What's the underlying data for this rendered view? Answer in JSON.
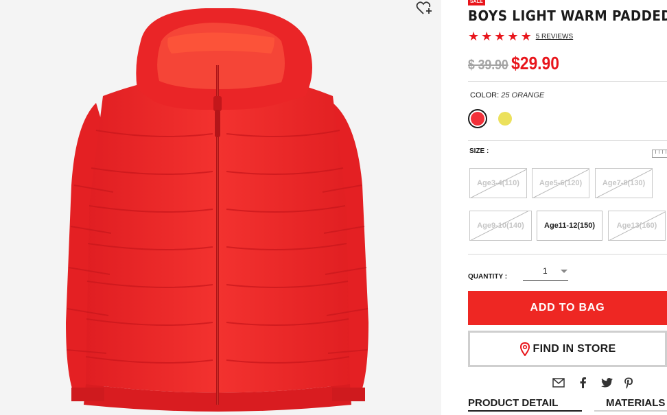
{
  "product": {
    "sale_badge": "SALE",
    "title": "BOYS LIGHT WARM PADDED P",
    "rating_stars": 5,
    "reviews_link": "5 REVIEWS",
    "old_price": "$ 39.90",
    "new_price": "$29.90"
  },
  "color": {
    "label": "COLOR:",
    "selected": "25 ORANGE",
    "swatches": [
      {
        "name": "orange",
        "hex": "#f2313a",
        "selected": true
      },
      {
        "name": "yellow",
        "hex": "#ece15c",
        "selected": false
      }
    ]
  },
  "size": {
    "label": "SIZE :",
    "options": [
      {
        "label": "Age3-4(110)",
        "available": false
      },
      {
        "label": "Age5-6(120)",
        "available": false
      },
      {
        "label": "Age7-8(130)",
        "available": false
      },
      {
        "label": "Age9-10(140)",
        "available": false
      },
      {
        "label": "Age11-12(150)",
        "available": true
      },
      {
        "label": "Age13(160)",
        "available": false
      }
    ]
  },
  "quantity": {
    "label": "QUANTITY :",
    "value": "1"
  },
  "actions": {
    "add_to_bag": "ADD TO BAG",
    "find_in_store": "FIND IN STORE"
  },
  "share_icons": [
    "mail-icon",
    "facebook-icon",
    "twitter-icon",
    "pinterest-icon"
  ],
  "tabs": [
    {
      "label": "PRODUCT DETAIL"
    },
    {
      "label": "MATERIALS"
    }
  ],
  "colors": {
    "accent_red": "#e8151b",
    "add_button": "#ee2723",
    "jacket": "#ef2a2a"
  }
}
